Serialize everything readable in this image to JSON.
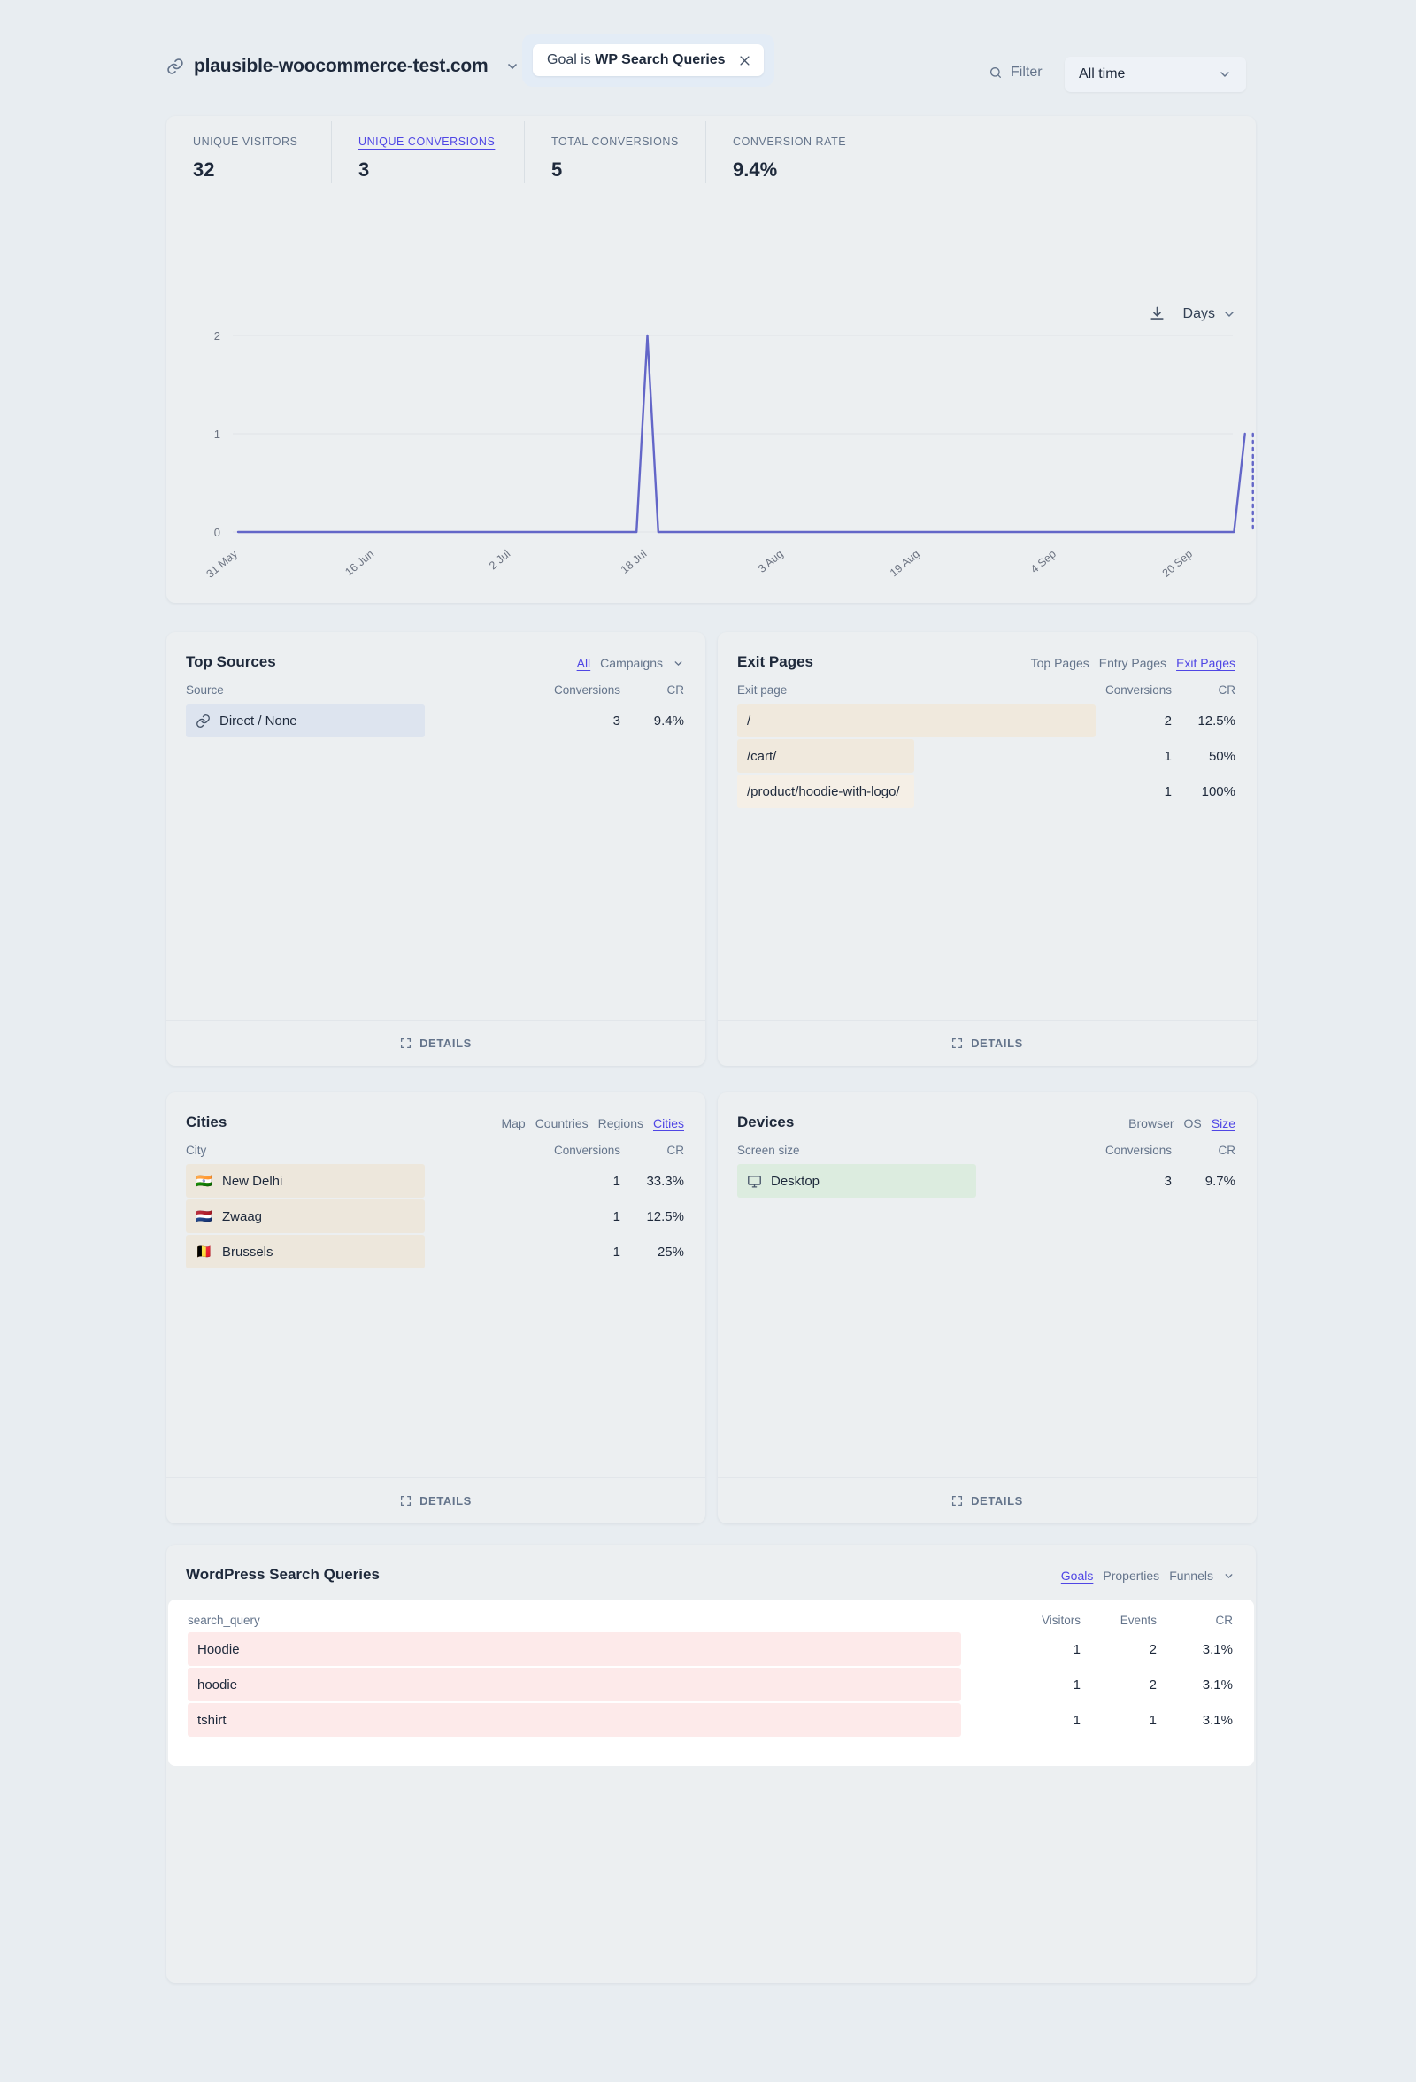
{
  "header": {
    "site_name": "plausible-woocommerce-test.com",
    "link_icon": "link-icon",
    "site_chevron": "chevron-down-icon",
    "filter_pill_prefix": "Goal is",
    "filter_pill_value": "WP Search Queries",
    "filter_pill_close": "close-icon",
    "filter_label": "Filter",
    "search_icon": "search-icon",
    "date_range": "All time",
    "date_chevron": "chevron-down-icon"
  },
  "kpis": [
    {
      "label": "UNIQUE VISITORS",
      "value": "32",
      "active": false
    },
    {
      "label": "UNIQUE CONVERSIONS",
      "value": "3",
      "active": true
    },
    {
      "label": "TOTAL CONVERSIONS",
      "value": "5",
      "active": false
    },
    {
      "label": "CONVERSION RATE",
      "value": "9.4%",
      "active": false
    }
  ],
  "chart_tools": {
    "download_icon": "download-icon",
    "interval_label": "Days",
    "interval_chevron": "chevron-down-icon"
  },
  "chart_data": {
    "type": "line",
    "title": "Unique conversions over time",
    "xlabel": "",
    "ylabel": "",
    "ylim": [
      0,
      2
    ],
    "yticks": [
      0,
      1,
      2
    ],
    "grid": true,
    "legend": false,
    "line_color": "#6366c8",
    "tick_labels": [
      "31 May",
      "16 Jun",
      "2 Jul",
      "18 Jul",
      "3 Aug",
      "19 Aug",
      "4 Sep",
      "20 Sep"
    ],
    "series": [
      {
        "name": "Unique conversions",
        "points": [
          {
            "x": "31 May",
            "y": 0
          },
          {
            "x": "16 Jun",
            "y": 0
          },
          {
            "x": "2 Jul",
            "y": 0
          },
          {
            "x": "17 Jul",
            "y": 0
          },
          {
            "x": "18 Jul",
            "y": 2
          },
          {
            "x": "19 Jul",
            "y": 0
          },
          {
            "x": "3 Aug",
            "y": 0
          },
          {
            "x": "19 Aug",
            "y": 0
          },
          {
            "x": "4 Sep",
            "y": 0
          },
          {
            "x": "25 Sep",
            "y": 0
          },
          {
            "x": "26 Sep",
            "y": 1
          }
        ]
      }
    ],
    "dashed_tail": {
      "from": "26 Sep",
      "y": 1,
      "note": "incomplete current period"
    }
  },
  "panels": {
    "top_sources": {
      "title": "Top Sources",
      "tabs": [
        {
          "label": "All",
          "active": true
        },
        {
          "label": "Campaigns",
          "active": false
        }
      ],
      "tab_chevron": "chevron-down-icon",
      "columns": {
        "name": "Source",
        "conversions": "Conversions",
        "cr": "CR"
      },
      "rows": [
        {
          "label": "Direct / None",
          "icon": "link-icon",
          "conversions": "3",
          "cr": "9.4%",
          "bar_pct": 100
        }
      ],
      "details_label": "DETAILS",
      "details_icon": "expand-icon",
      "bar_color": "#dde4ef"
    },
    "exit_pages": {
      "title": "Exit Pages",
      "tabs": [
        {
          "label": "Top Pages",
          "active": false
        },
        {
          "label": "Entry Pages",
          "active": false
        },
        {
          "label": "Exit Pages",
          "active": true
        }
      ],
      "columns": {
        "name": "Exit page",
        "conversions": "Conversions",
        "cr": "CR"
      },
      "rows": [
        {
          "label": "/",
          "conversions": "2",
          "cr": "12.5%",
          "bar_pct": 100
        },
        {
          "label": "/cart/",
          "conversions": "1",
          "cr": "50%",
          "bar_pct": 49
        },
        {
          "label": "/product/hoodie-with-logo/",
          "conversions": "1",
          "cr": "100%",
          "bar_pct": 49
        }
      ],
      "details_label": "DETAILS",
      "details_icon": "expand-icon",
      "bar_color": "#f0e9dd"
    },
    "cities": {
      "title": "Cities",
      "tabs": [
        {
          "label": "Map",
          "active": false
        },
        {
          "label": "Countries",
          "active": false
        },
        {
          "label": "Regions",
          "active": false
        },
        {
          "label": "Cities",
          "active": true
        }
      ],
      "columns": {
        "name": "City",
        "conversions": "Conversions",
        "cr": "CR"
      },
      "rows": [
        {
          "label": "New Delhi",
          "flag": "🇮🇳",
          "conversions": "1",
          "cr": "33.3%",
          "bar_pct": 100
        },
        {
          "label": "Zwaag",
          "flag": "🇳🇱",
          "conversions": "1",
          "cr": "12.5%",
          "bar_pct": 100
        },
        {
          "label": "Brussels",
          "flag": "🇧🇪",
          "conversions": "1",
          "cr": "25%",
          "bar_pct": 100
        }
      ],
      "details_label": "DETAILS",
      "details_icon": "expand-icon",
      "bar_color": "#ede7dc"
    },
    "devices": {
      "title": "Devices",
      "tabs": [
        {
          "label": "Browser",
          "active": false
        },
        {
          "label": "OS",
          "active": false
        },
        {
          "label": "Size",
          "active": true
        }
      ],
      "columns": {
        "name": "Screen size",
        "conversions": "Conversions",
        "cr": "CR"
      },
      "rows": [
        {
          "label": "Desktop",
          "icon": "monitor-icon",
          "conversions": "3",
          "cr": "9.7%",
          "bar_pct": 100
        }
      ],
      "details_label": "DETAILS",
      "details_icon": "expand-icon",
      "bar_color": "#dcecdf"
    },
    "search_queries": {
      "title": "WordPress Search Queries",
      "tabs": [
        {
          "label": "Goals",
          "active": true
        },
        {
          "label": "Properties",
          "active": false
        },
        {
          "label": "Funnels",
          "active": false
        }
      ],
      "tab_chevron": "chevron-down-icon",
      "columns": {
        "name": "search_query",
        "visitors": "Visitors",
        "events": "Events",
        "cr": "CR"
      },
      "rows": [
        {
          "label": "Hoodie",
          "visitors": "1",
          "events": "2",
          "cr": "3.1%",
          "bar_pct": 100
        },
        {
          "label": "hoodie",
          "visitors": "1",
          "events": "2",
          "cr": "3.1%",
          "bar_pct": 100
        },
        {
          "label": "tshirt",
          "visitors": "1",
          "events": "1",
          "cr": "3.1%",
          "bar_pct": 100
        }
      ],
      "bar_color": "#fdeaea"
    }
  }
}
